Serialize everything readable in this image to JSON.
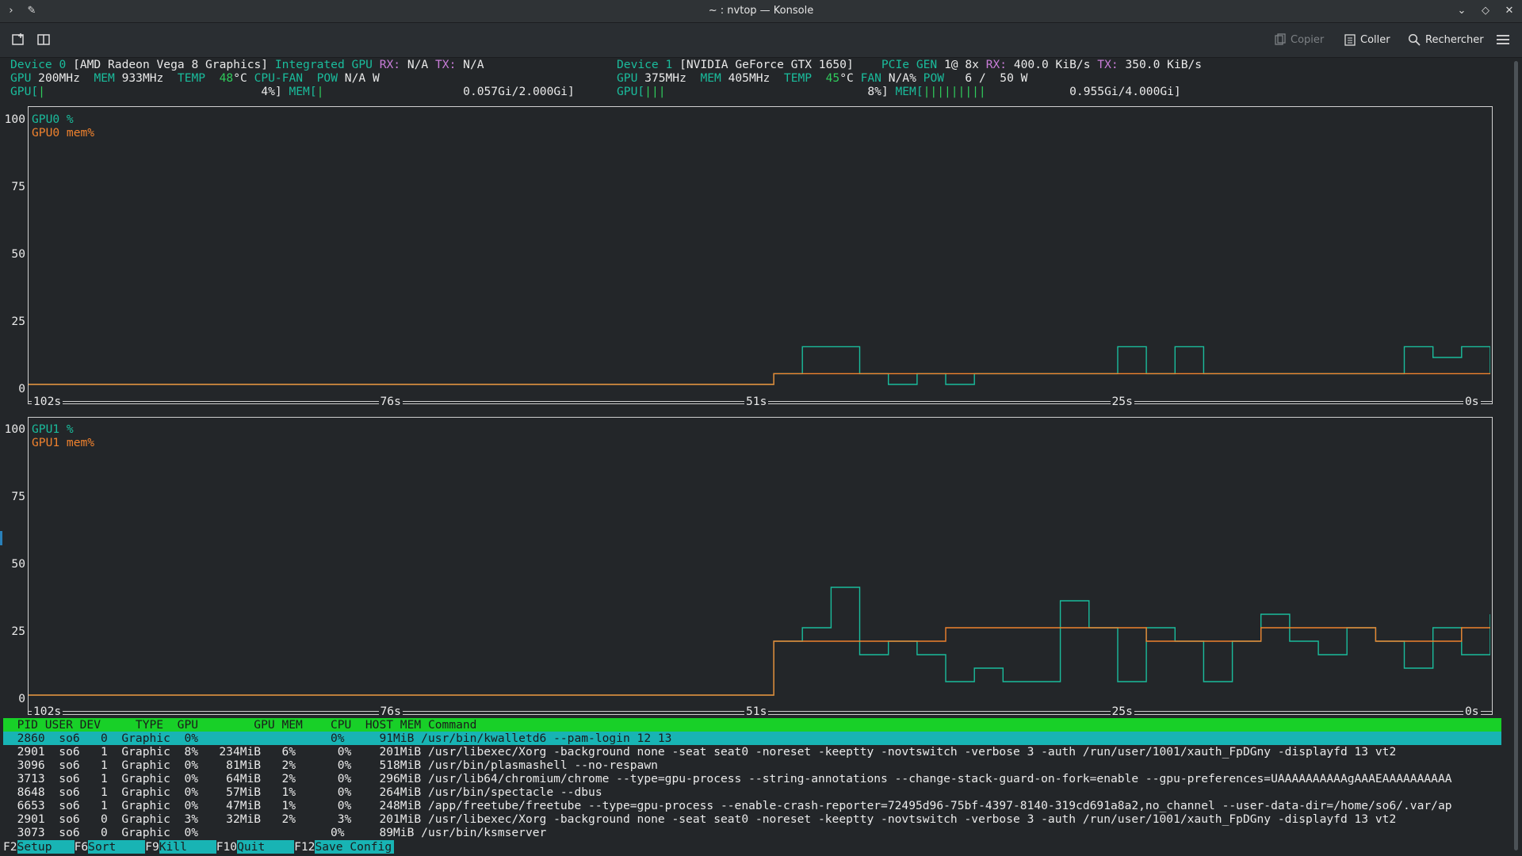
{
  "window": {
    "title": "~ : nvtop — Konsole"
  },
  "toolbar": {
    "copy_label": "Copier",
    "paste_label": "Coller",
    "search_label": "Rechercher"
  },
  "devices": {
    "d0_line1": [
      {
        "t": "Device 0 ",
        "c": "cyan"
      },
      {
        "t": "[AMD Radeon Vega 8 Graphics] ",
        "c": "white"
      },
      {
        "t": "Integrated GPU ",
        "c": "cyan"
      },
      {
        "t": "RX: ",
        "c": "mag"
      },
      {
        "t": "N/A ",
        "c": "white"
      },
      {
        "t": "TX: ",
        "c": "mag"
      },
      {
        "t": "N/A",
        "c": "white"
      }
    ],
    "d0_line2": [
      {
        "t": "GPU ",
        "c": "cyan"
      },
      {
        "t": "200MHz  ",
        "c": "white"
      },
      {
        "t": "MEM ",
        "c": "cyan"
      },
      {
        "t": "933MHz  ",
        "c": "white"
      },
      {
        "t": "TEMP  ",
        "c": "cyan"
      },
      {
        "t": "48",
        "c": "green"
      },
      {
        "t": "°C ",
        "c": "white"
      },
      {
        "t": "CPU-FAN  ",
        "c": "cyan"
      },
      {
        "t": "POW ",
        "c": "cyan"
      },
      {
        "t": "N/A W",
        "c": "white"
      }
    ],
    "d0_line3": [
      {
        "t": "GPU[",
        "c": "cyan"
      },
      {
        "t": "|",
        "c": "green"
      },
      {
        "t": "                               4%] ",
        "c": "white"
      },
      {
        "t": "MEM[",
        "c": "cyan"
      },
      {
        "t": "|",
        "c": "green"
      },
      {
        "t": "                    0.057Gi/2.000Gi]",
        "c": "white"
      }
    ],
    "d1_line1": [
      {
        "t": "Device 1 ",
        "c": "cyan"
      },
      {
        "t": "[NVIDIA GeForce GTX 1650]    ",
        "c": "white"
      },
      {
        "t": "PCIe GEN ",
        "c": "cyan"
      },
      {
        "t": "1@ 8x ",
        "c": "white"
      },
      {
        "t": "RX: ",
        "c": "mag"
      },
      {
        "t": "400.0 KiB/s ",
        "c": "white"
      },
      {
        "t": "TX: ",
        "c": "mag"
      },
      {
        "t": "350.0 KiB/s",
        "c": "white"
      }
    ],
    "d1_line2": [
      {
        "t": "GPU ",
        "c": "cyan"
      },
      {
        "t": "375MHz  ",
        "c": "white"
      },
      {
        "t": "MEM ",
        "c": "cyan"
      },
      {
        "t": "405MHz  ",
        "c": "white"
      },
      {
        "t": "TEMP  ",
        "c": "cyan"
      },
      {
        "t": "45",
        "c": "green"
      },
      {
        "t": "°C ",
        "c": "white"
      },
      {
        "t": "FAN ",
        "c": "cyan"
      },
      {
        "t": "N/A% ",
        "c": "white"
      },
      {
        "t": "POW   ",
        "c": "cyan"
      },
      {
        "t": "6 /  50 W",
        "c": "white"
      }
    ],
    "d1_line3": [
      {
        "t": "GPU[",
        "c": "cyan"
      },
      {
        "t": "|||",
        "c": "green"
      },
      {
        "t": "                             8%] ",
        "c": "white"
      },
      {
        "t": "MEM[",
        "c": "cyan"
      },
      {
        "t": "|||||||||",
        "c": "green"
      },
      {
        "t": "            0.955Gi/4.000Gi]",
        "c": "white"
      }
    ]
  },
  "graph_labels": {
    "gpu0_util": "GPU0 %",
    "gpu0_mem": "GPU0 mem%",
    "gpu1_util": "GPU1 %",
    "gpu1_mem": "GPU1 mem%",
    "y_ticks": [
      "100",
      "75",
      "50",
      "25",
      "0"
    ],
    "x_ticks": [
      "102s",
      "76s",
      "51s",
      "25s",
      "0s"
    ]
  },
  "chart_data": [
    {
      "type": "line",
      "title": "",
      "xlabel": "",
      "ylabel": "",
      "ylim": [
        0,
        100
      ],
      "x_ticks": [
        "102s",
        "76s",
        "51s",
        "25s",
        "0s"
      ],
      "x": [
        102,
        100,
        98,
        96,
        94,
        92,
        90,
        88,
        86,
        84,
        82,
        80,
        78,
        76,
        74,
        72,
        70,
        68,
        66,
        64,
        62,
        60,
        58,
        56,
        54,
        52,
        50,
        48,
        46,
        44,
        42,
        40,
        38,
        36,
        34,
        32,
        30,
        28,
        26,
        24,
        22,
        20,
        18,
        16,
        14,
        12,
        10,
        8,
        6,
        4,
        2,
        0
      ],
      "series": [
        {
          "name": "GPU0 %",
          "color": "#1abc9c",
          "values": [
            0,
            0,
            0,
            0,
            0,
            0,
            0,
            0,
            0,
            0,
            0,
            0,
            0,
            0,
            0,
            0,
            0,
            0,
            0,
            0,
            0,
            0,
            0,
            0,
            0,
            0,
            4,
            14,
            14,
            4,
            0,
            4,
            0,
            4,
            4,
            4,
            4,
            4,
            14,
            4,
            14,
            4,
            4,
            4,
            4,
            4,
            4,
            4,
            14,
            10,
            14,
            4
          ]
        },
        {
          "name": "GPU0 mem%",
          "color": "#f0822e",
          "values": [
            0,
            0,
            0,
            0,
            0,
            0,
            0,
            0,
            0,
            0,
            0,
            0,
            0,
            0,
            0,
            0,
            0,
            0,
            0,
            0,
            0,
            0,
            0,
            0,
            0,
            0,
            4,
            4,
            4,
            4,
            4,
            4,
            4,
            4,
            4,
            4,
            4,
            4,
            4,
            4,
            4,
            4,
            4,
            4,
            4,
            4,
            4,
            4,
            4,
            4,
            4,
            4
          ]
        }
      ]
    },
    {
      "type": "line",
      "title": "",
      "xlabel": "",
      "ylabel": "",
      "ylim": [
        0,
        100
      ],
      "x_ticks": [
        "102s",
        "76s",
        "51s",
        "25s",
        "0s"
      ],
      "x": [
        102,
        100,
        98,
        96,
        94,
        92,
        90,
        88,
        86,
        84,
        82,
        80,
        78,
        76,
        74,
        72,
        70,
        68,
        66,
        64,
        62,
        60,
        58,
        56,
        54,
        52,
        50,
        48,
        46,
        44,
        42,
        40,
        38,
        36,
        34,
        32,
        30,
        28,
        26,
        24,
        22,
        20,
        18,
        16,
        14,
        12,
        10,
        8,
        6,
        4,
        2,
        0
      ],
      "series": [
        {
          "name": "GPU1 %",
          "color": "#1abc9c",
          "values": [
            0,
            0,
            0,
            0,
            0,
            0,
            0,
            0,
            0,
            0,
            0,
            0,
            0,
            0,
            0,
            0,
            0,
            0,
            0,
            0,
            0,
            0,
            0,
            0,
            0,
            0,
            20,
            25,
            40,
            15,
            20,
            15,
            5,
            10,
            5,
            5,
            35,
            25,
            5,
            25,
            20,
            5,
            20,
            30,
            20,
            15,
            25,
            20,
            10,
            25,
            15,
            30
          ]
        },
        {
          "name": "GPU1 mem%",
          "color": "#f0822e",
          "values": [
            0,
            0,
            0,
            0,
            0,
            0,
            0,
            0,
            0,
            0,
            0,
            0,
            0,
            0,
            0,
            0,
            0,
            0,
            0,
            0,
            0,
            0,
            0,
            0,
            0,
            0,
            20,
            20,
            20,
            20,
            20,
            20,
            25,
            25,
            25,
            25,
            25,
            25,
            25,
            20,
            20,
            20,
            20,
            25,
            25,
            25,
            25,
            20,
            20,
            20,
            25,
            25
          ]
        }
      ]
    }
  ],
  "processes": {
    "header": "  PID USER DEV     TYPE  GPU        GPU MEM    CPU  HOST MEM Command",
    "rows": [
      "  2860  so6   0  Graphic  0%                   0%     91MiB /usr/bin/kwalletd6 --pam-login 12 13",
      "  2901  so6   1  Graphic  8%   234MiB   6%      0%    201MiB /usr/libexec/Xorg -background none -seat seat0 -noreset -keeptty -novtswitch -verbose 3 -auth /run/user/1001/xauth_FpDGny -displayfd 13 vt2",
      "  3096  so6   1  Graphic  0%    81MiB   2%      0%    518MiB /usr/bin/plasmashell --no-respawn",
      "  3713  so6   1  Graphic  0%    64MiB   2%      0%    296MiB /usr/lib64/chromium/chrome --type=gpu-process --string-annotations --change-stack-guard-on-fork=enable --gpu-preferences=UAAAAAAAAAAgAAAEAAAAAAAAAA",
      "  8648  so6   1  Graphic  0%    57MiB   1%      0%    264MiB /usr/bin/spectacle --dbus",
      "  6653  so6   1  Graphic  0%    47MiB   1%      0%    248MiB /app/freetube/freetube --type=gpu-process --enable-crash-reporter=72495d96-75bf-4397-8140-319cd691a8a2,no_channel --user-data-dir=/home/so6/.var/ap",
      "  2901  so6   0  Graphic  3%    32MiB   2%      3%    201MiB /usr/libexec/Xorg -background none -seat seat0 -noreset -keeptty -novtswitch -verbose 3 -auth /run/user/1001/xauth_FpDGny -displayfd 13 vt2",
      "  3073  so6   0  Graphic  0%                   0%     89MiB /usr/bin/ksmserver"
    ]
  },
  "fkeys": [
    {
      "key": "F2",
      "label": "Setup"
    },
    {
      "key": "F6",
      "label": "Sort"
    },
    {
      "key": "F9",
      "label": "Kill"
    },
    {
      "key": "F10",
      "label": "Quit"
    },
    {
      "key": "F12",
      "label": "Save Config"
    }
  ]
}
